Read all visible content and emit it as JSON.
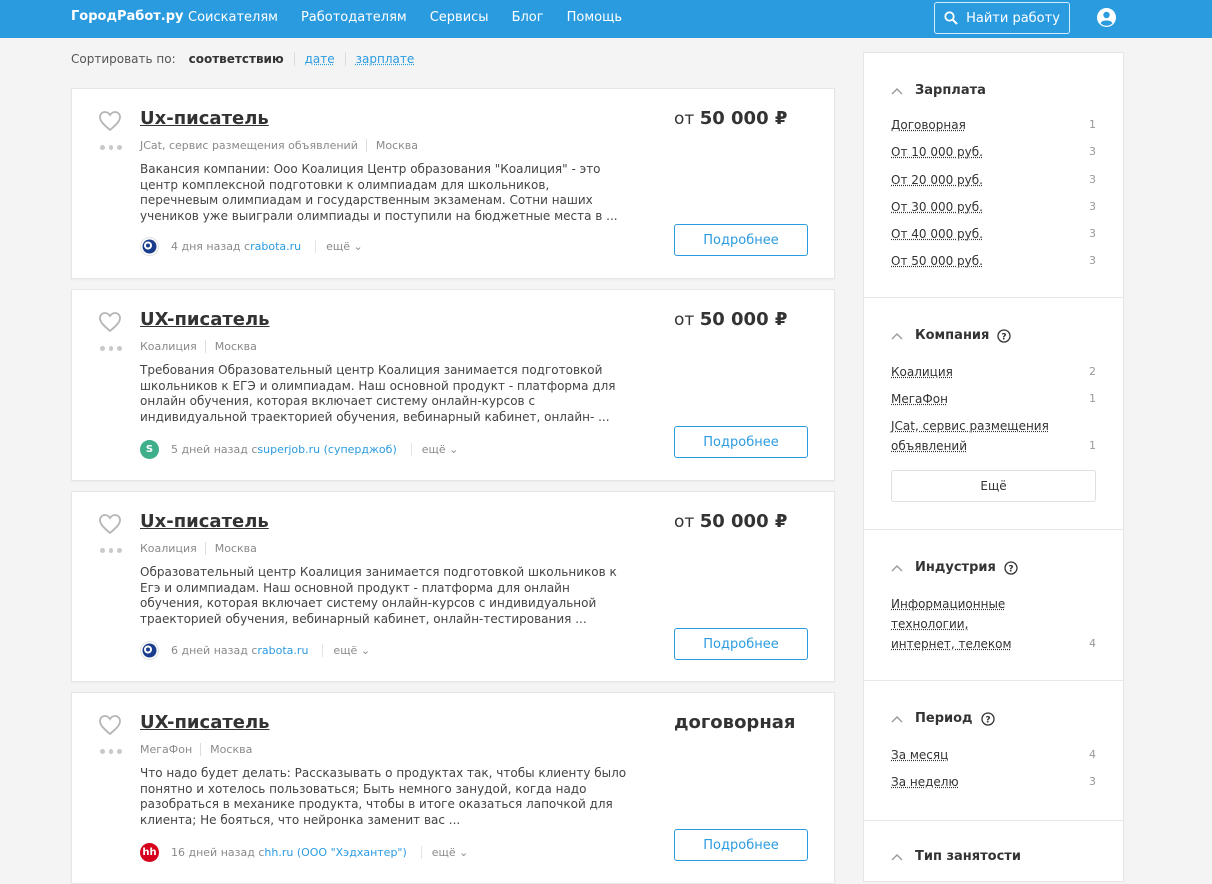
{
  "header": {
    "logo": "ГородРабот.ру",
    "nav": [
      "Соискателям",
      "Работодателям",
      "Сервисы",
      "Блог",
      "Помощь"
    ],
    "find_button": "Найти работу"
  },
  "sort": {
    "label": "Сортировать по:",
    "active": "соответствию",
    "options": [
      "дате",
      "зарплате"
    ]
  },
  "jobs": [
    {
      "title": "Ux-писатель",
      "company": "JCat, сервис размещения объявлений",
      "city": "Москва",
      "description": "Вакансия компании: Ооо Коалиция Центр образования \"Коалиция\" - это центр комплексной подготовки к олимпиадам для школьников, перечневым олимпиадам и государственным экзаменам. Сотни наших учеников уже выиграли олимпиады и поступили на бюджетные места в ...",
      "posted": "4 дня назад с ",
      "source": "rabota.ru",
      "more": "ещё",
      "salary_prefix": "от",
      "salary": "50 000 ₽",
      "button": "Подробнее"
    },
    {
      "title": "UX-писатель",
      "company": "Коалиция",
      "city": "Москва",
      "description": "Требования Образовательный центр Коалиция занимается подготовкой школьников к ЕГЭ и олимпиадам. Наш основной продукт - платформа для онлайн обучения, которая включает систему онлайн-курсов с индивидуальной траекторией обучения, вебинарный кабинет, онлайн- ...",
      "posted": "5 дней назад с ",
      "source": "superjob.ru (суперджоб)",
      "more": "ещё",
      "salary_prefix": "от",
      "salary": "50 000 ₽",
      "button": "Подробнее"
    },
    {
      "title": "Ux-писатель",
      "company": "Коалиция",
      "city": "Москва",
      "description": "Образовательный центр Коалиция занимается подготовкой школьников к Егэ и олимпиадам. Наш основной продукт - платформа для онлайн обучения, которая включает систему онлайн-курсов с индивидуальной траекторией обучения, вебинарный кабинет, онлайн-тестирования ...",
      "posted": "6 дней назад с ",
      "source": "rabota.ru",
      "more": "ещё",
      "salary_prefix": "от",
      "salary": "50 000 ₽",
      "button": "Подробнее"
    },
    {
      "title": "UX-писатель",
      "company": "МегаФон",
      "city": "Москва",
      "description": "Что надо будет делать: Рассказывать о продуктах так, чтобы клиенту было понятно и хотелось пользоваться; Быть немного занудой, когда надо разобраться в механике продукта, чтобы в итоге оказаться лапочкой для клиента; Не бояться, что нейронка заменит вас ...",
      "posted": "16 дней назад с ",
      "source": "hh.ru (ООО \"Хэдхантер\")",
      "more": "ещё",
      "salary_prefix": "",
      "salary": "договорная",
      "button": "Подробнее"
    }
  ],
  "filters": {
    "salary": {
      "title": "Зарплата",
      "items": [
        {
          "label": "Договорная",
          "count": "1"
        },
        {
          "label": "От 10 000 руб.",
          "count": "3"
        },
        {
          "label": "От 20 000 руб.",
          "count": "3"
        },
        {
          "label": "От 30 000 руб.",
          "count": "3"
        },
        {
          "label": "От 40 000 руб.",
          "count": "3"
        },
        {
          "label": "От 50 000 руб.",
          "count": "3"
        }
      ]
    },
    "company": {
      "title": "Компания",
      "items": [
        {
          "label": "Коалиция",
          "count": "2"
        },
        {
          "label": "МегаФон",
          "count": "1"
        },
        {
          "label": "JCat, сервис размещения объявлений",
          "count": "1"
        }
      ],
      "more": "Ещё"
    },
    "industry": {
      "title": "Индустрия",
      "items": [
        {
          "label": "Информационные технологии, интернет, телеком",
          "count": "4"
        }
      ]
    },
    "period": {
      "title": "Период",
      "items": [
        {
          "label": "За месяц",
          "count": "4"
        },
        {
          "label": "За неделю",
          "count": "3"
        }
      ]
    },
    "employment": {
      "title": "Тип занятости"
    }
  },
  "colors": {
    "header_bg": "#2b9be0",
    "accent": "#2b9be0",
    "page_bg": "#f4f4f4"
  }
}
